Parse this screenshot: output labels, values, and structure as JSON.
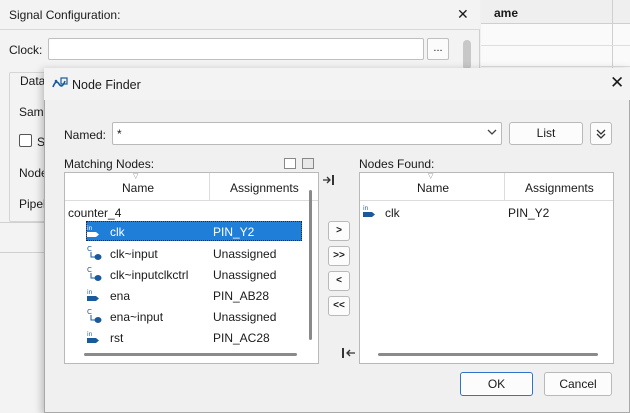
{
  "background_window": {
    "title": "Signal Configuration:",
    "close_glyph": "✕",
    "clock_label": "Clock:",
    "clock_value": "",
    "browse_label": "...",
    "data_label": "Data",
    "sam_label": "Sam",
    "s_label": "S",
    "node_label": "Node",
    "pipel_label": "Pipel"
  },
  "right_table": {
    "header_fragment": "ame"
  },
  "dialog": {
    "title": "Node Finder",
    "close_glyph": "✕",
    "named_label": "Named:",
    "named_value": "*",
    "list_button": "List",
    "matching_label": "Matching Nodes:",
    "found_label": "Nodes Found:",
    "ok_label": "OK",
    "cancel_label": "Cancel",
    "transfer_buttons": [
      ">",
      ">>",
      "<",
      "<<"
    ]
  },
  "matching_nodes": {
    "columns": [
      "Name",
      "Assignments"
    ],
    "group": "counter_4",
    "rows": [
      {
        "type": "in",
        "name": "clk",
        "assignment": "PIN_Y2",
        "selected": true
      },
      {
        "type": "comb",
        "name": "clk~input",
        "assignment": "Unassigned",
        "selected": false
      },
      {
        "type": "comb",
        "name": "clk~inputclkctrl",
        "assignment": "Unassigned",
        "selected": false
      },
      {
        "type": "in",
        "name": "ena",
        "assignment": "PIN_AB28",
        "selected": false
      },
      {
        "type": "comb",
        "name": "ena~input",
        "assignment": "Unassigned",
        "selected": false
      },
      {
        "type": "in",
        "name": "rst",
        "assignment": "PIN_AC28",
        "selected": false
      }
    ]
  },
  "nodes_found": {
    "columns": [
      "Name",
      "Assignments"
    ],
    "rows": [
      {
        "type": "in",
        "name": "clk",
        "assignment": "PIN_Y2"
      }
    ]
  },
  "colors": {
    "selection": "#1f7fd8",
    "icon_blue": "#1a5a9c",
    "default_button_border": "#2f72c9"
  }
}
